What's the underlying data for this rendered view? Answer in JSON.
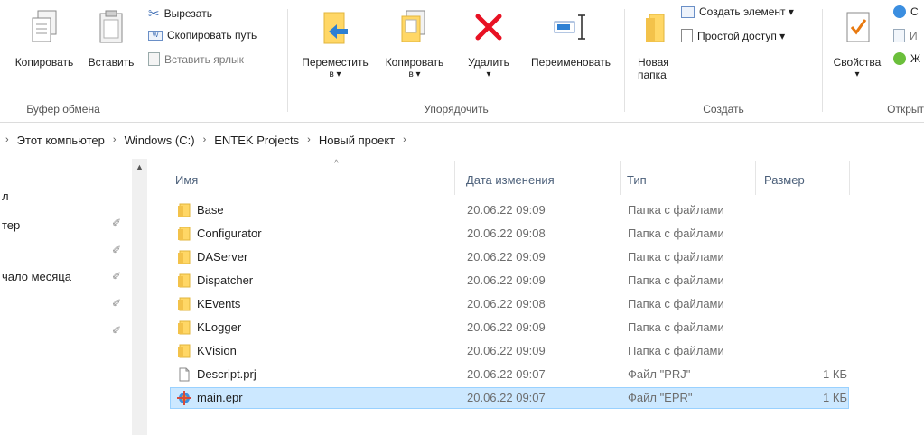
{
  "ribbon": {
    "clipboard": {
      "copy_label": "Копировать",
      "paste_label": "Вставить",
      "cut_label": "Вырезать",
      "copy_path_label": "Скопировать путь",
      "paste_shortcut_label": "Вставить ярлык",
      "group_label": "Буфер обмена"
    },
    "organize": {
      "move_line1": "Переместить",
      "move_line2": "в ▾",
      "copy_line1": "Копировать",
      "copy_line2": "в ▾",
      "delete_label": "Удалить",
      "delete_caret": "▾",
      "rename_label": "Переименовать",
      "group_label": "Упорядочить"
    },
    "new": {
      "new_folder_line1": "Новая",
      "new_folder_line2": "папка",
      "new_item_label": "Создать элемент ▾",
      "easy_access_label": "Простой доступ ▾",
      "group_label": "Создать"
    },
    "open": {
      "properties_label": "Свойства",
      "properties_caret": "▾",
      "open_label_partial": "С",
      "edit_label_partial": "И",
      "history_label_partial": "Ж",
      "group_label": "Открыт"
    }
  },
  "address": {
    "crumbs": [
      "Этот компьютер",
      "Windows (C:)",
      "ENTEK Projects",
      "Новый проект"
    ]
  },
  "nav": {
    "items": [
      "л",
      "тер",
      "",
      "чало месяца",
      "",
      ""
    ]
  },
  "columns": {
    "name": "Имя",
    "date": "Дата изменения",
    "type": "Тип",
    "size": "Размер"
  },
  "files": [
    {
      "name": "Base",
      "date": "20.06.22 09:09",
      "type": "Папка с файлами",
      "size": "",
      "kind": "folder"
    },
    {
      "name": "Configurator",
      "date": "20.06.22 09:08",
      "type": "Папка с файлами",
      "size": "",
      "kind": "folder"
    },
    {
      "name": "DAServer",
      "date": "20.06.22 09:09",
      "type": "Папка с файлами",
      "size": "",
      "kind": "folder"
    },
    {
      "name": "Dispatcher",
      "date": "20.06.22 09:09",
      "type": "Папка с файлами",
      "size": "",
      "kind": "folder"
    },
    {
      "name": "KEvents",
      "date": "20.06.22 09:08",
      "type": "Папка с файлами",
      "size": "",
      "kind": "folder"
    },
    {
      "name": "KLogger",
      "date": "20.06.22 09:09",
      "type": "Папка с файлами",
      "size": "",
      "kind": "folder"
    },
    {
      "name": "KVision",
      "date": "20.06.22 09:09",
      "type": "Папка с файлами",
      "size": "",
      "kind": "folder"
    },
    {
      "name": "Descript.prj",
      "date": "20.06.22 09:07",
      "type": "Файл \"PRJ\"",
      "size": "1 КБ",
      "kind": "file"
    },
    {
      "name": "main.epr",
      "date": "20.06.22 09:07",
      "type": "Файл \"EPR\"",
      "size": "1 КБ",
      "kind": "epr"
    }
  ],
  "colors": {
    "selection_bg": "#cce8ff",
    "selection_border": "#99d1ff",
    "folder_yellow": "#ffd766",
    "delete_red": "#e81123",
    "header_text": "#4c607a"
  }
}
